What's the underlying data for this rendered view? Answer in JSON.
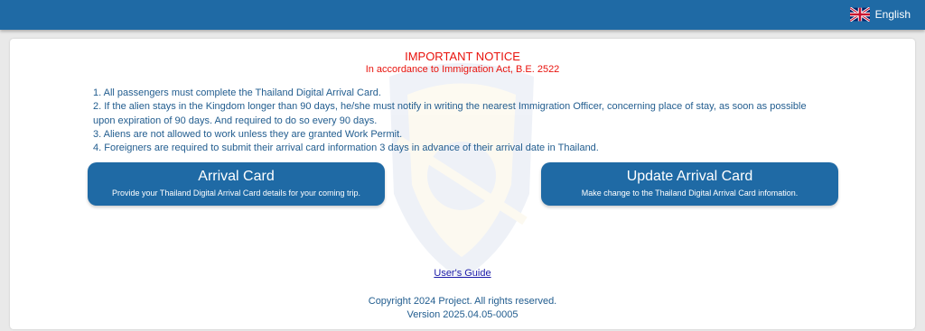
{
  "header": {
    "language_label": "English",
    "language_icon": "uk-flag-icon",
    "bar_color": "#1f6aa5"
  },
  "notice": {
    "title": "IMPORTANT NOTICE",
    "subtitle": "In accordance to Immigration Act, B.E. 2522",
    "rules": [
      "1. All passengers must complete the Thailand Digital Arrival Card.",
      "2. If the alien stays in the Kingdom longer than 90 days, he/she must notify in writing the nearest Immigration Officer, concerning place of stay, as soon as possible upon expiration of 90 days. And required to do so every 90 days.",
      "3. Aliens are not allowed to work unless they are granted Work Permit.",
      "4. Foreigners are required to submit their arrival card information 3 days in advance of their arrival date in Thailand."
    ],
    "text_color": "#e8120c"
  },
  "actions": {
    "arrival_title": "Arrival Card",
    "arrival_desc": "Provide your Thailand Digital Arrival Card details for your coming trip.",
    "update_title": "Update Arrival Card",
    "update_desc": "Make change to the Thailand Digital Arrival Card infomation."
  },
  "footer": {
    "guide_link": "User's Guide",
    "copyright": "Copyright 2024 Project. All rights reserved.",
    "version": "Version 2025.04.05-0005"
  },
  "watermark_icon": "immigration-bureau-emblem-icon"
}
